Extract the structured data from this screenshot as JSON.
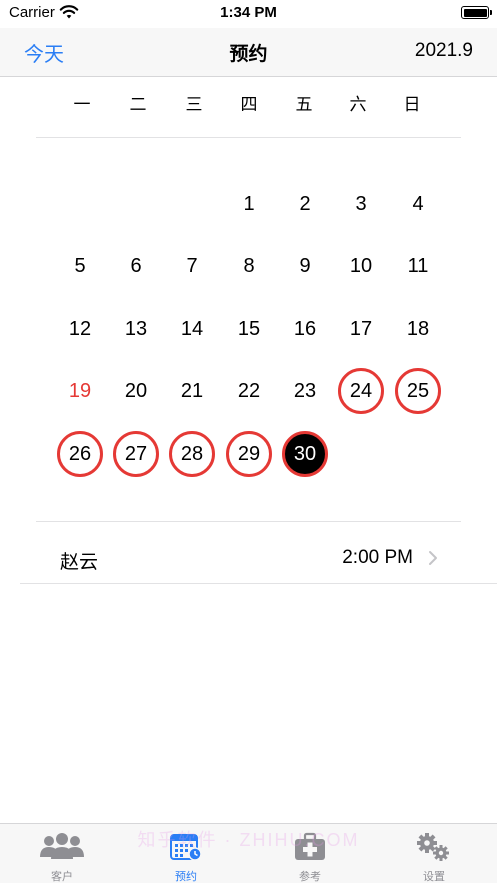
{
  "status_bar": {
    "carrier": "Carrier",
    "time": "1:34 PM"
  },
  "nav": {
    "left_label": "今天",
    "title": "预约",
    "right_label": "2021.9"
  },
  "weekdays": [
    "一",
    "二",
    "三",
    "四",
    "五",
    "六",
    "日"
  ],
  "calendar": {
    "days": [
      {
        "label": "1",
        "col": 3,
        "row": 0,
        "state": "normal"
      },
      {
        "label": "2",
        "col": 4,
        "row": 0,
        "state": "normal"
      },
      {
        "label": "3",
        "col": 5,
        "row": 0,
        "state": "normal"
      },
      {
        "label": "4",
        "col": 6,
        "row": 0,
        "state": "normal"
      },
      {
        "label": "5",
        "col": 0,
        "row": 1,
        "state": "normal"
      },
      {
        "label": "6",
        "col": 1,
        "row": 1,
        "state": "normal"
      },
      {
        "label": "7",
        "col": 2,
        "row": 1,
        "state": "normal"
      },
      {
        "label": "8",
        "col": 3,
        "row": 1,
        "state": "normal"
      },
      {
        "label": "9",
        "col": 4,
        "row": 1,
        "state": "normal"
      },
      {
        "label": "10",
        "col": 5,
        "row": 1,
        "state": "normal"
      },
      {
        "label": "11",
        "col": 6,
        "row": 1,
        "state": "normal"
      },
      {
        "label": "12",
        "col": 0,
        "row": 2,
        "state": "normal"
      },
      {
        "label": "13",
        "col": 1,
        "row": 2,
        "state": "normal"
      },
      {
        "label": "14",
        "col": 2,
        "row": 2,
        "state": "normal"
      },
      {
        "label": "15",
        "col": 3,
        "row": 2,
        "state": "normal"
      },
      {
        "label": "16",
        "col": 4,
        "row": 2,
        "state": "normal"
      },
      {
        "label": "17",
        "col": 5,
        "row": 2,
        "state": "normal"
      },
      {
        "label": "18",
        "col": 6,
        "row": 2,
        "state": "normal"
      },
      {
        "label": "19",
        "col": 0,
        "row": 3,
        "state": "sunday"
      },
      {
        "label": "20",
        "col": 1,
        "row": 3,
        "state": "normal"
      },
      {
        "label": "21",
        "col": 2,
        "row": 3,
        "state": "normal"
      },
      {
        "label": "22",
        "col": 3,
        "row": 3,
        "state": "normal"
      },
      {
        "label": "23",
        "col": 4,
        "row": 3,
        "state": "normal"
      },
      {
        "label": "24",
        "col": 5,
        "row": 3,
        "state": "booked"
      },
      {
        "label": "25",
        "col": 6,
        "row": 3,
        "state": "booked"
      },
      {
        "label": "26",
        "col": 0,
        "row": 4,
        "state": "booked"
      },
      {
        "label": "27",
        "col": 1,
        "row": 4,
        "state": "booked"
      },
      {
        "label": "28",
        "col": 2,
        "row": 4,
        "state": "booked"
      },
      {
        "label": "29",
        "col": 3,
        "row": 4,
        "state": "booked"
      },
      {
        "label": "30",
        "col": 4,
        "row": 4,
        "state": "selected"
      }
    ]
  },
  "appointment": {
    "name": "赵云",
    "time": "2:00 PM"
  },
  "tabs": [
    {
      "label": "客户",
      "icon": "people-icon",
      "active": false
    },
    {
      "label": "预约",
      "icon": "calendar-icon",
      "active": true
    },
    {
      "label": "参考",
      "icon": "medical-kit-icon",
      "active": false
    },
    {
      "label": "设置",
      "icon": "gears-icon",
      "active": false
    }
  ],
  "watermark": "知乎软件 · ZHIHU.COM",
  "colors": {
    "accent": "#2a7ef5",
    "booked": "#e53935",
    "sunday": "#e53935",
    "selected_fill": "#000000"
  }
}
